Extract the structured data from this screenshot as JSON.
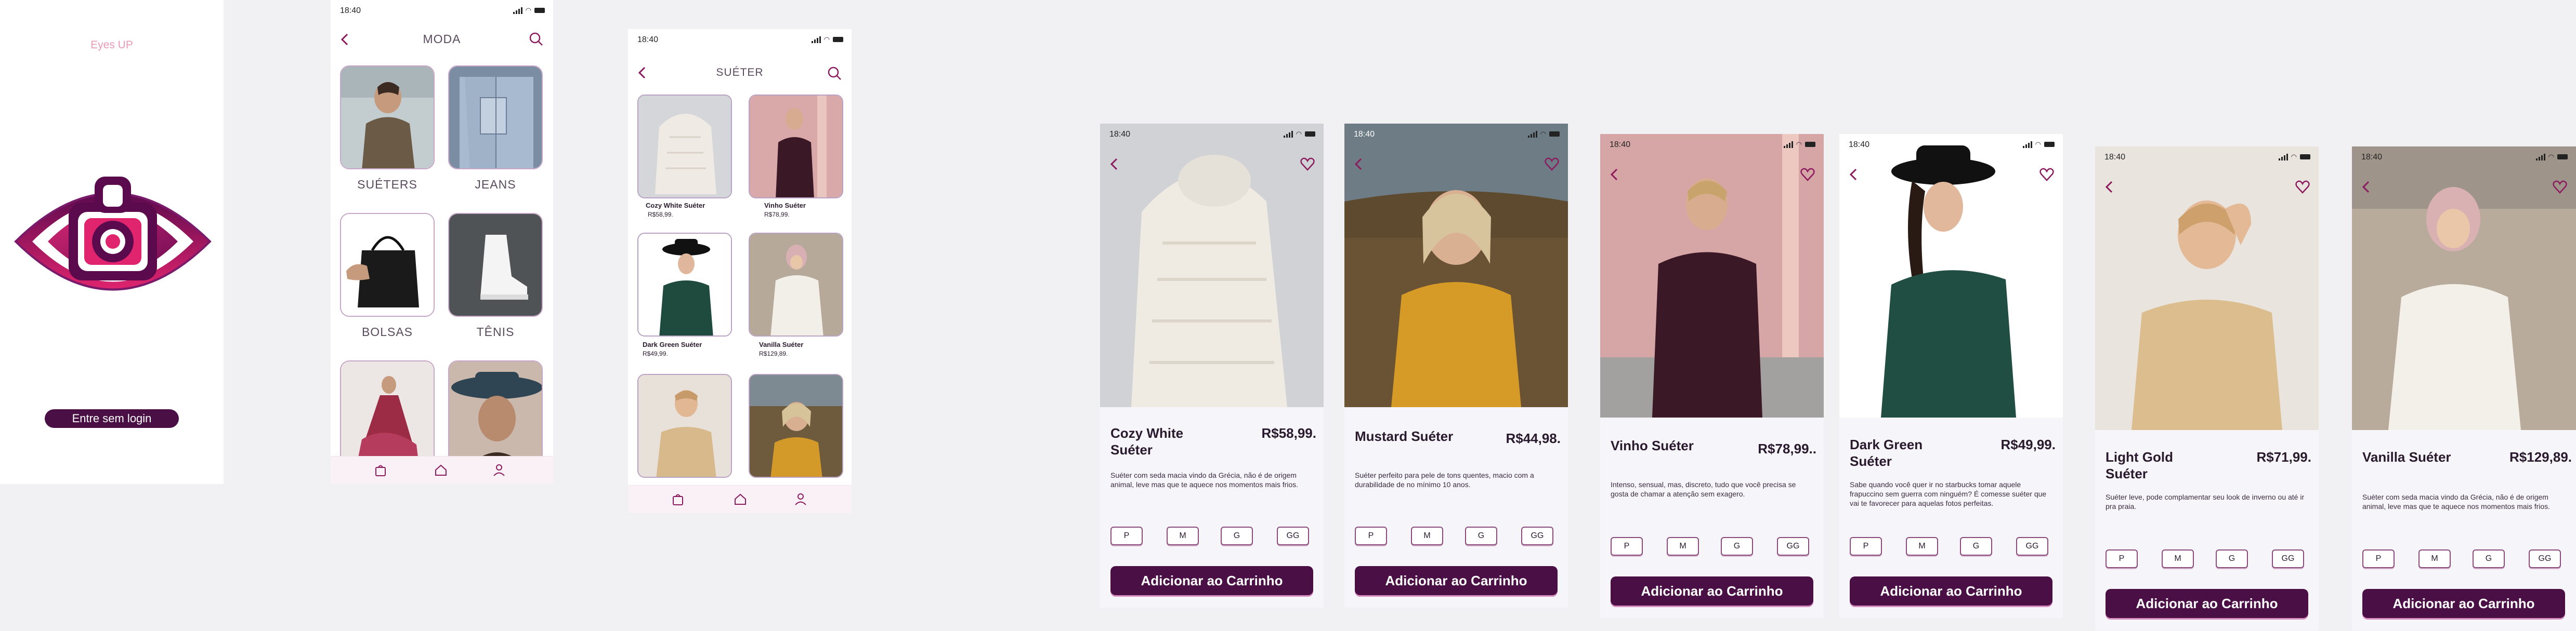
{
  "colors": {
    "accent": "#8c1a5e",
    "primary_button": "#4a1046",
    "nav_bg": "#f9f1f6",
    "tile_border": "#c8a6c8",
    "logo_top": "#5c0a4e",
    "logo_bottom": "#e0246e"
  },
  "splash": {
    "brand": "Eyes UP",
    "login_button": "Entre sem login"
  },
  "status": {
    "time": "18:40"
  },
  "categories_screen": {
    "title": "MODA",
    "items": [
      {
        "label": "SUÉTERS"
      },
      {
        "label": "JEANS"
      },
      {
        "label": "BOLSAS"
      },
      {
        "label": "TÊNIS"
      },
      {
        "label": ""
      },
      {
        "label": ""
      }
    ]
  },
  "sweater_list": {
    "title": "SUÉTER",
    "items": [
      {
        "name": "Cozy White Suéter",
        "price": "R$58,99."
      },
      {
        "name": "Vinho Suéter",
        "price": "R$78,99."
      },
      {
        "name": "Dark Green Suéter",
        "price": "R$49,99."
      },
      {
        "name": "Vanilla Suéter",
        "price": "R$129,89."
      },
      {
        "name": "",
        "price": ""
      },
      {
        "name": "",
        "price": ""
      }
    ]
  },
  "nav": {
    "icons": [
      "bag-icon",
      "home-icon",
      "user-icon"
    ]
  },
  "sizes": [
    "P",
    "M",
    "G",
    "GG"
  ],
  "add_to_cart": "Adicionar ao Carrinho",
  "products": [
    {
      "name": "Cozy White Suéter",
      "price": "R$58,99.",
      "description": "Suéter com seda macia vindo da Grécia, não é de origem animal, leve mas que te aquece nos momentos mais frios."
    },
    {
      "name": "Mustard Suéter",
      "price": "R$44,98.",
      "description": "Suéter perfeito para pele de tons quentes, macio com a durabilidade de no mínimo 10 anos."
    },
    {
      "name": "Vinho Suéter",
      "price": "R$78,99..",
      "description": "Intenso, sensual, mas, discreto, tudo que você precisa se gosta de chamar a atenção sem exagero."
    },
    {
      "name": "Dark Green Suéter",
      "price": "R$49,99.",
      "description": "Sabe quando você quer ir no starbucks tomar aquele frapuccino sem guerra com ninguém? É comesse suéter que vai te favorecer para aquelas fotos perfeitas."
    },
    {
      "name": "Light Gold Suéter",
      "price": "R$71,99.",
      "description": "Suéter leve, pode complamentar seu look de inverno ou até ir pra praia."
    },
    {
      "name": "Vanilla Suéter",
      "price": "R$129,89.",
      "description": "Suéter com seda macia vindo da Grécia, não é de origem animal, leve mas que te aquece nos momentos mais frios."
    }
  ]
}
